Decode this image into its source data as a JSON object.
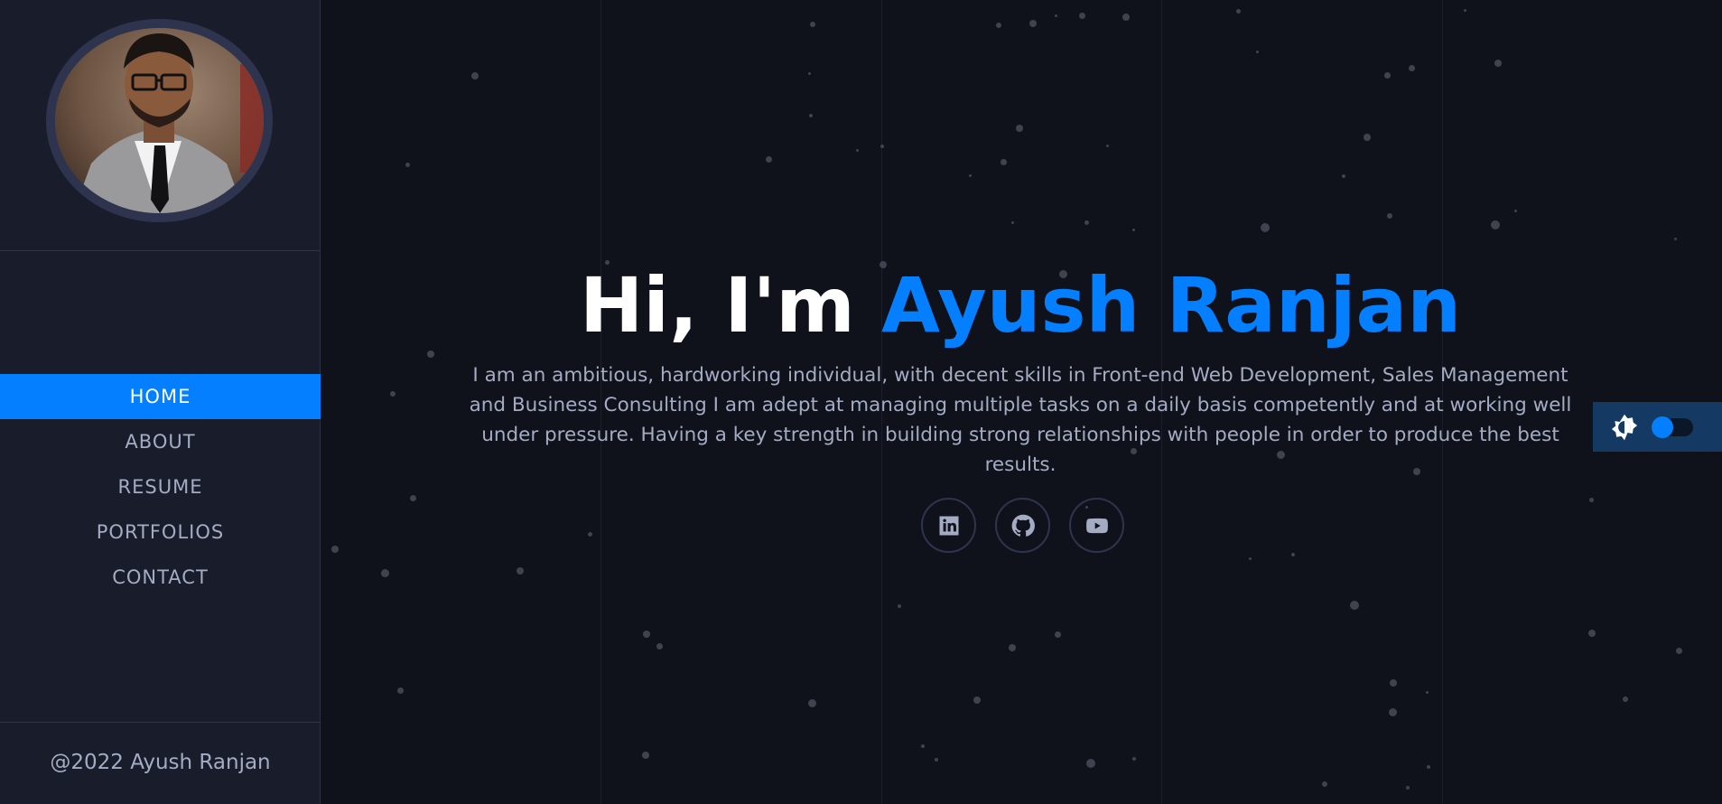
{
  "sidebar": {
    "nav": [
      {
        "label": "Home",
        "active": true
      },
      {
        "label": "About",
        "active": false
      },
      {
        "label": "Resume",
        "active": false
      },
      {
        "label": "Portfolios",
        "active": false
      },
      {
        "label": "Contact",
        "active": false
      }
    ],
    "footer": "@2022 Ayush Ranjan"
  },
  "hero": {
    "greeting": "Hi, I'm ",
    "name": "Ayush Ranjan",
    "bio": "I am an ambitious, hardworking individual, with decent skills in Front-end Web Development, Sales Management and Business Consulting I am adept at managing multiple tasks on a daily basis competently and at working well under pressure. Having a key strength in building strong relationships with people in order to produce the best results."
  },
  "socials": [
    {
      "icon": "linkedin-icon"
    },
    {
      "icon": "github-icon"
    },
    {
      "icon": "youtube-icon"
    }
  ],
  "theme_toggle": {
    "icon": "brightness-icon",
    "mode": "dark"
  },
  "colors": {
    "accent": "#037fff",
    "sidebar_bg": "#191d2b",
    "main_bg": "#10121b",
    "text_muted": "#a4acc4",
    "heading": "#ffffff"
  }
}
